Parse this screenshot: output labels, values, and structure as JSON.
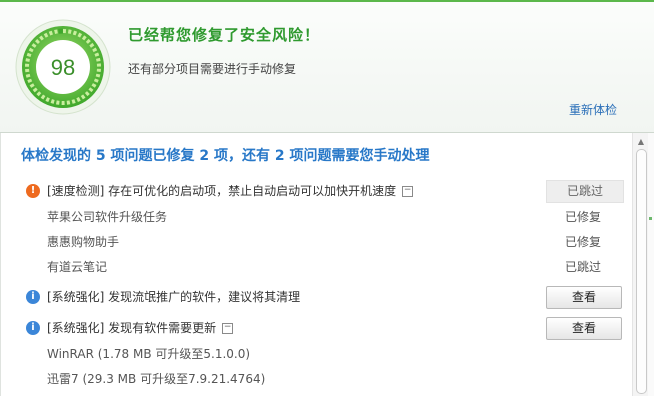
{
  "score": {
    "value": "98",
    "level": 0.98,
    "color": "#4fb83c"
  },
  "header": {
    "title": "已经帮您修复了安全风险！",
    "subtitle": "还有部分项目需要进行手动修复",
    "recheck_label": "重新体检"
  },
  "summary": "体检发现的 5 项问题已修复 2 项，还有 2 项问题需要您手动处理",
  "issues": [
    {
      "icon": "warning-icon",
      "icon_char": "!",
      "text": "[速度检测] 存在可优化的启动项，禁止自动启动可以加快开机速度",
      "collapse": "−",
      "status": "已跳过",
      "children": [
        {
          "text": "苹果公司软件升级任务",
          "status": "已修复"
        },
        {
          "text": "惠惠购物助手",
          "status": "已修复"
        },
        {
          "text": "有道云笔记",
          "status": "已跳过"
        }
      ]
    },
    {
      "icon": "info-icon",
      "icon_char": "i",
      "text": "[系统强化] 发现流氓推广的软件，建议将其清理",
      "button": "查看"
    },
    {
      "icon": "info-icon",
      "icon_char": "i",
      "text": "[系统强化] 发现有软件需要更新",
      "collapse": "−",
      "button": "查看",
      "children": [
        {
          "text": "WinRAR (1.78 MB 可升级至5.1.0.0)"
        },
        {
          "text": "迅雷7 (29.3 MB 可升级至7.9.21.4764)"
        }
      ]
    }
  ],
  "scrollbar": {
    "up_arrow": "▲"
  }
}
